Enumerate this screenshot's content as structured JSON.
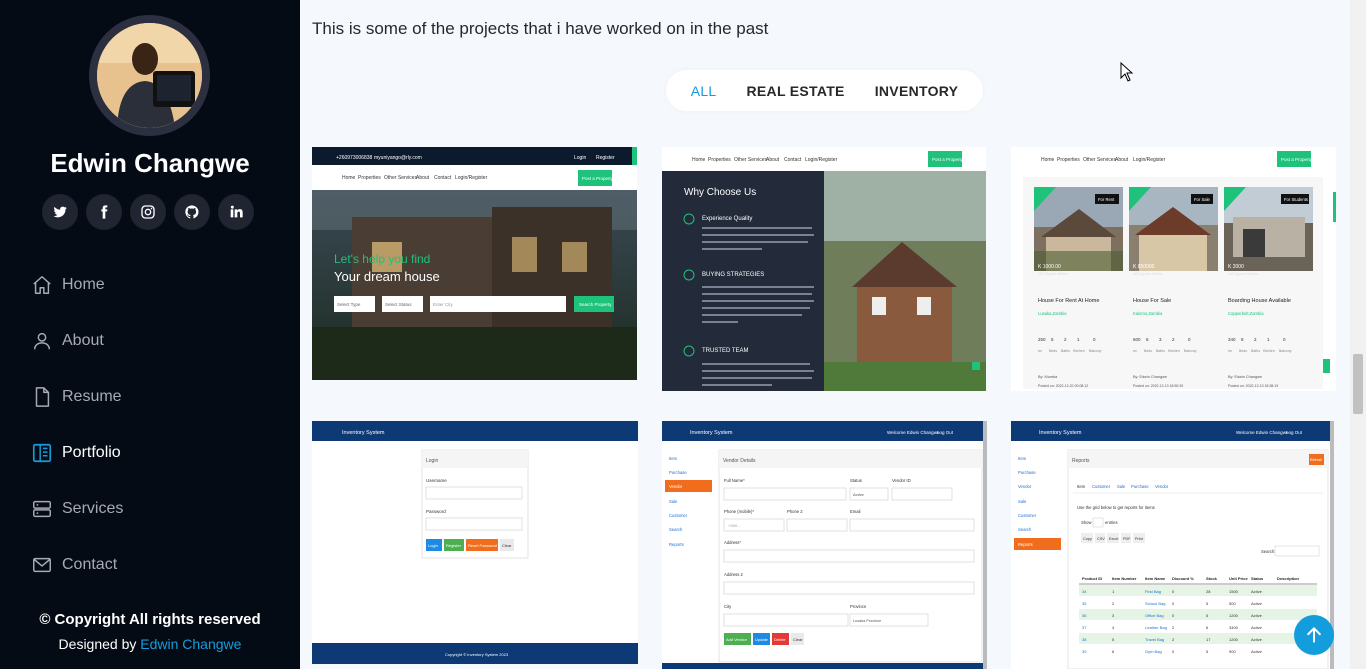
{
  "profile": {
    "name": "Edwin Changwe"
  },
  "social": [
    {
      "icon": "twitter-icon"
    },
    {
      "icon": "facebook-icon"
    },
    {
      "icon": "instagram-icon"
    },
    {
      "icon": "github-icon"
    },
    {
      "icon": "linkedin-icon"
    }
  ],
  "nav": {
    "items": [
      {
        "label": "Home",
        "icon": "home-icon"
      },
      {
        "label": "About",
        "icon": "person-icon"
      },
      {
        "label": "Resume",
        "icon": "file-icon"
      },
      {
        "label": "Portfolio",
        "icon": "portfolio-icon",
        "active": true
      },
      {
        "label": "Services",
        "icon": "server-icon"
      },
      {
        "label": "Contact",
        "icon": "envelope-icon"
      }
    ]
  },
  "footer": {
    "copyright": "© Copyright All rights reserved",
    "designed_prefix": "Designed by ",
    "designed_name": "Edwin Changwe"
  },
  "portfolio": {
    "intro": "This is some of the projects that i have worked on in the past",
    "filters": [
      "ALL",
      "REAL ESTATE",
      "INVENTORY"
    ],
    "active_filter": "ALL"
  },
  "card1": {
    "phone": "+260973006838",
    "email": "myuniyango@rly.com",
    "login": "Login",
    "register": "Register",
    "menu": [
      "Home",
      "Properties",
      "Other Services",
      "About",
      "Contact",
      "Login/Register"
    ],
    "cta": "Post a Property",
    "headline1": "Let's help you find",
    "headline2": "Your dream house",
    "select_type": "Select Type",
    "select_status": "Select Status",
    "city_placeholder": "Enter City",
    "search_btn": "Search Property"
  },
  "card2": {
    "menu": [
      "Home",
      "Properties",
      "Other Services",
      "About",
      "Contact",
      "Login/Register"
    ],
    "cta": "Post a Property",
    "heading": "Why Choose Us",
    "sections": [
      {
        "title": "Experience Quality",
        "text": "Nyumba Yango is a no. 1 real estate platform that's tried and trusted by a lot of people because of its efficiency, reliability, and technical foundations among others."
      },
      {
        "title": "BUYING STRATEGIES",
        "text": "We use modern technology along with our trusted knowledge, unsurpassed negotiation and sales skills, professional experience and collaboration to assist you in identifying your desired property and securing the best price and terms while protecting your interests."
      },
      {
        "title": "TRUSTED TEAM",
        "text": "Every single day we take a stand for our clients. As expert real estate strategists we simply won't do the deal unless it's a great deal and you are completely happy."
      }
    ]
  },
  "card3": {
    "menu": [
      "Home",
      "Properties",
      "Other Services",
      "About",
      "Login/Register"
    ],
    "cta": "Post a Property",
    "listings": [
      {
        "badge": "For Rent",
        "price": "K 1000.00",
        "area": "250 Square Metres",
        "title": "House For Rent At Home",
        "location": "Lusaka,Zambia",
        "stats": [
          "250",
          "5",
          "2",
          "1",
          "0"
        ],
        "agent": "By: Mumba",
        "posted": "Posted on: 2022-12-20 00:08:12"
      },
      {
        "badge": "For Sale",
        "price": "K 850000",
        "area": "600 Square Metres",
        "title": "House For Sale",
        "location": "Kalomo,Zambia",
        "stats": [
          "600",
          "6",
          "3",
          "2",
          "0"
        ],
        "agent": "By: Edwin Changwe",
        "posted": "Posted on: 2022-12-13 18:50:29"
      },
      {
        "badge": "For Students",
        "price": "K 2000",
        "area": "240 Square Metres",
        "title": "Boarding House Available",
        "location": "Copperbelt,Zambia",
        "stats": [
          "340",
          "8",
          "2",
          "1",
          "0"
        ],
        "agent": "By: Edwin Changwe",
        "posted": "Posted on: 2022-12-13 18:38:19"
      }
    ],
    "stat_labels": [
      "m²",
      "Beds",
      "Baths",
      "Kitchen",
      "Balcony"
    ]
  },
  "card4": {
    "brand": "Inventory System",
    "panel_title": "Login",
    "username_label": "Username",
    "password_label": "Password",
    "buttons": [
      "Login",
      "Register",
      "Reset Password",
      "Clear"
    ],
    "footer": "Copyright © Inventory System 2023"
  },
  "card5": {
    "brand": "Inventory System",
    "welcome": "Welcome Edwin Changwe",
    "logout": "Log Out",
    "menu": [
      "Item",
      "Purchase",
      "Vendor",
      "Sale",
      "Customer",
      "Search",
      "Reports"
    ],
    "active_menu": "Vendor",
    "panel_title": "Vendor Details",
    "fields": [
      "Full Name*",
      "Status",
      "Vendor ID",
      "Phone (mobile)*",
      "Phone 2",
      "Email",
      "Address*",
      "Address 2",
      "City",
      "Province"
    ],
    "status_value": "Active",
    "phone_placeholder": "+260...",
    "province_value": "Lusaka Province",
    "buttons": [
      "Add Vendor",
      "Update",
      "Delete",
      "Clear"
    ]
  },
  "card6": {
    "brand": "Inventory System",
    "welcome": "Welcome Edwin Changwe",
    "logout": "Log Out",
    "menu": [
      "Item",
      "Purchase",
      "Vendor",
      "Sale",
      "Customer",
      "Search",
      "Reports"
    ],
    "active_menu": "Reports",
    "panel_title": "Reports",
    "refresh": "Refresh",
    "tabs": [
      "Item",
      "Customer",
      "Sale",
      "Purchase",
      "Vendor"
    ],
    "hint": "Use the grid below to get reports for items",
    "show": "Show",
    "entries": "entries",
    "export_buttons": [
      "Copy",
      "CSV",
      "Excel",
      "PDF",
      "Print"
    ],
    "search_label": "Search:",
    "columns": [
      "Product ID",
      "Item Number",
      "Item Name",
      "Discount %",
      "Stock",
      "Unit Price",
      "Status",
      "Description"
    ],
    "rows": [
      [
        "34",
        "1",
        "First Bag",
        "0",
        "28",
        "1500",
        "Active"
      ],
      [
        "35",
        "2",
        "School Bag",
        "0",
        "5",
        "500",
        "Active"
      ],
      [
        "36",
        "3",
        "Office Bag",
        "0",
        "5",
        "1200",
        "Active"
      ],
      [
        "37",
        "4",
        "Leather Bag",
        "2",
        "6",
        "3400",
        "Active"
      ],
      [
        "38",
        "5",
        "Travel Bag",
        "2",
        "17",
        "1200",
        "Active"
      ],
      [
        "39",
        "6",
        "Gym Bag",
        "0",
        "5",
        "900",
        "Active"
      ]
    ]
  },
  "colors": {
    "accent": "#149ddd",
    "sidebar_bg": "#040b14",
    "green": "#1ec27a",
    "navy": "#0d3a74",
    "orange": "#f16d1d"
  }
}
